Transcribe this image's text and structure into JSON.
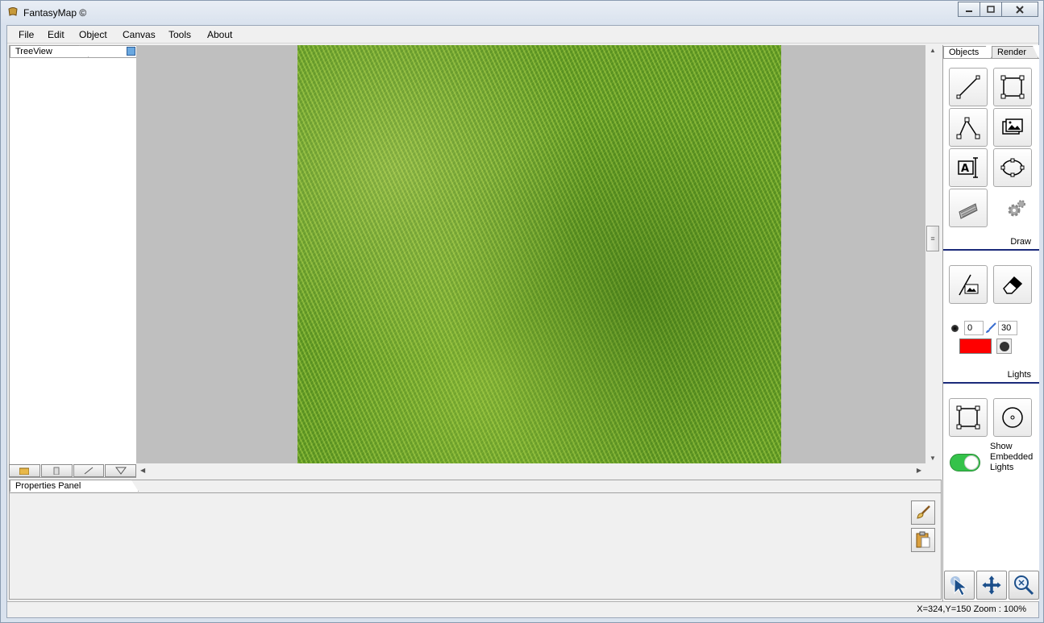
{
  "window": {
    "title": "FantasyMap ©"
  },
  "menu": [
    "File",
    "Edit",
    "Object",
    "Canvas",
    "Tools",
    "About"
  ],
  "treeview": {
    "tab_label": "TreeView"
  },
  "properties": {
    "tab_label": "Properties Panel"
  },
  "right_panel": {
    "tabs": [
      "Objects",
      "Render"
    ],
    "draw_label": "Draw",
    "lights_label": "Lights",
    "brush_size": "0",
    "brush_opacity": "30",
    "brush_color": "#ff0000",
    "show_lights_label": "Show Embedded Lights",
    "show_lights_on": true
  },
  "status": {
    "text": "X=324,Y=150  Zoom : 100%"
  }
}
